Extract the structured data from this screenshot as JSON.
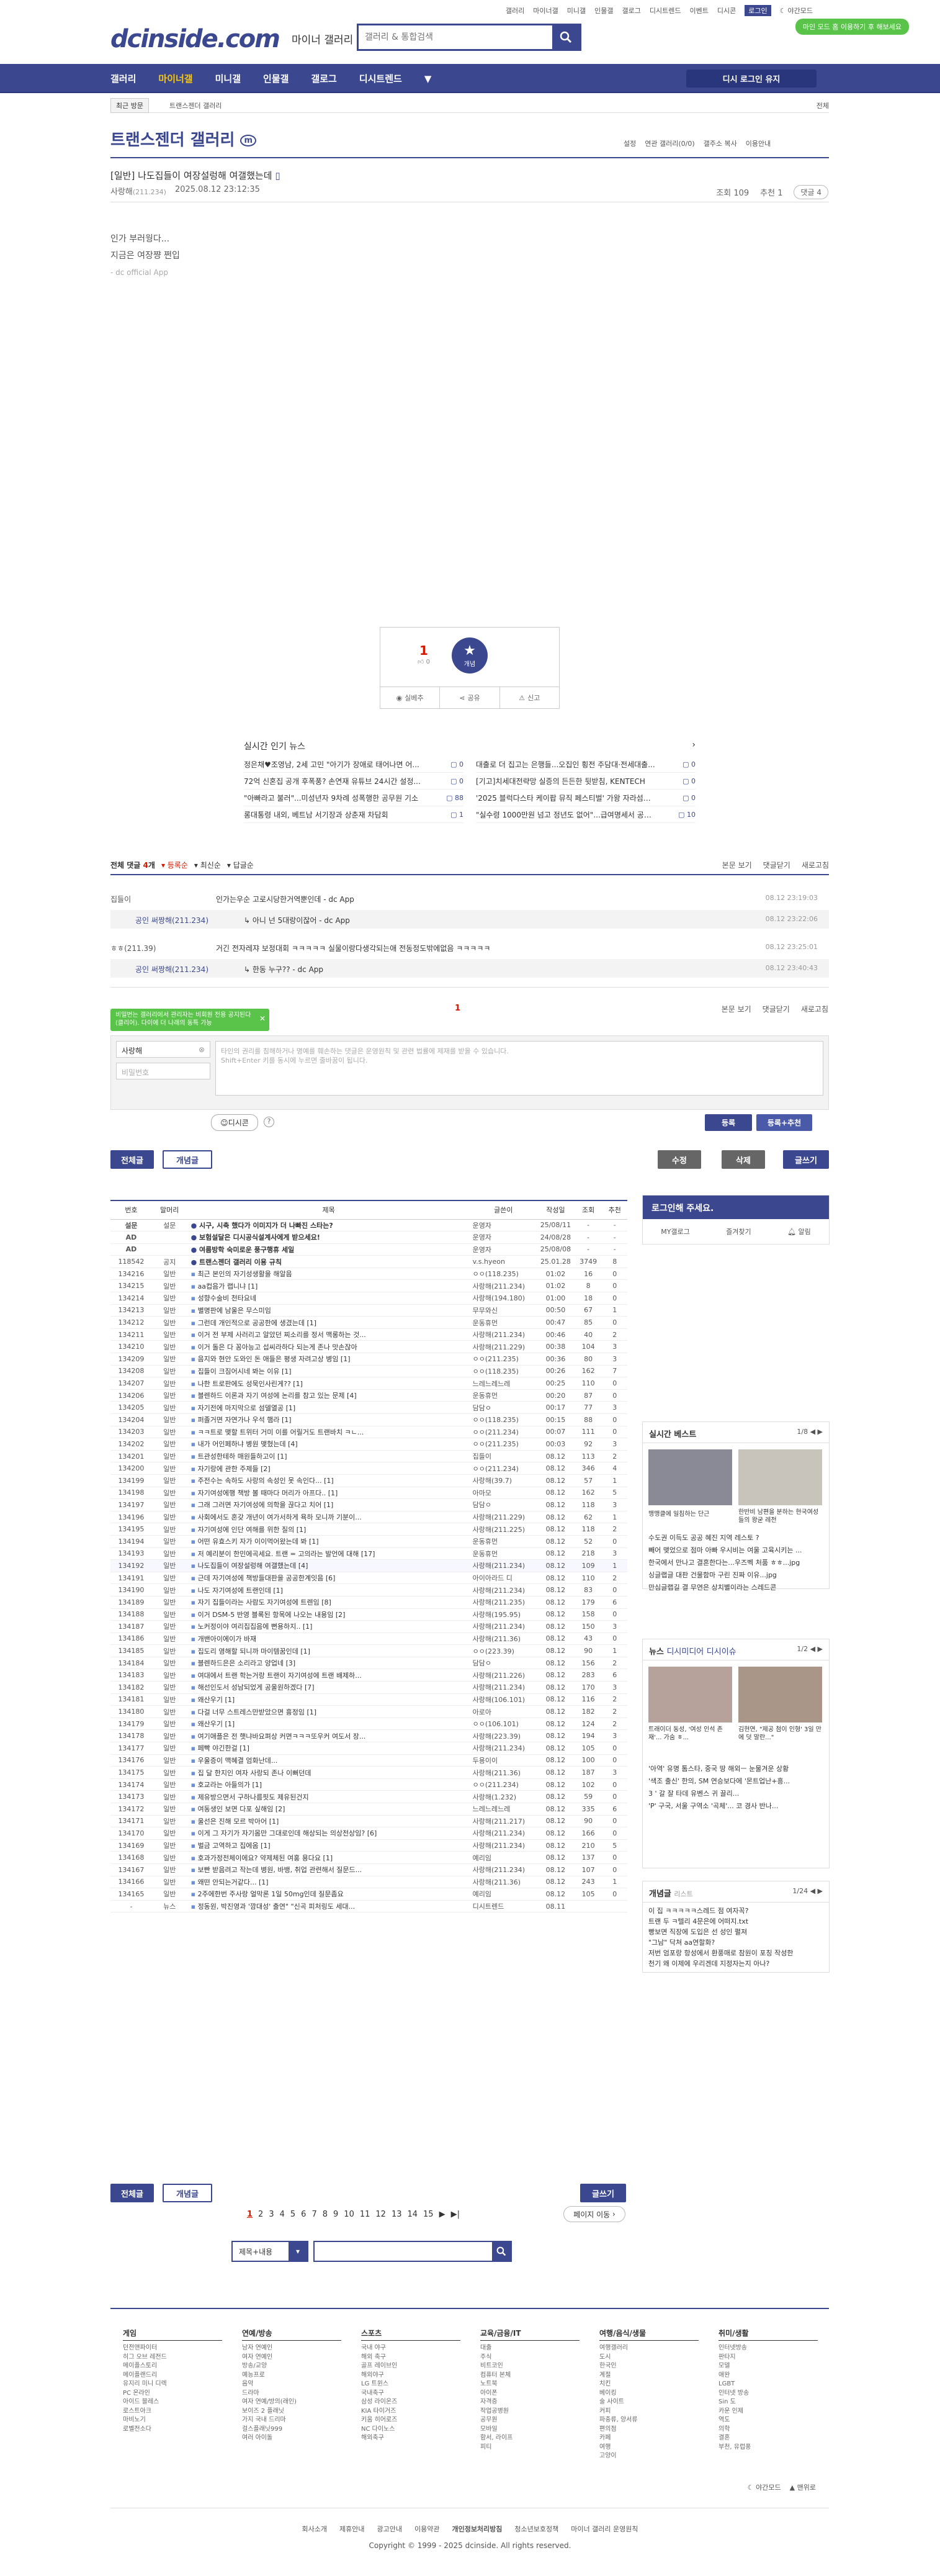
{
  "top_nav": {
    "items": [
      "갤러리",
      "마이너갤",
      "미니갤",
      "인물갤",
      "갤로그",
      "디시트렌드",
      "이벤트",
      "디시콘"
    ],
    "login": "로그인",
    "dark": "야간모드",
    "widget": "마인 모드 홈 이용하기 후 해보세요"
  },
  "brand": {
    "logo": "dcinside.com",
    "sub": "마이너 갤러리",
    "search_placeholder": "갤러리 & 통합검색"
  },
  "gnb": {
    "items": [
      "갤러리",
      "마이너갤",
      "미니갤",
      "인물갤",
      "갤로그",
      "디시트렌드"
    ],
    "active": "마이너갤",
    "my_button": "디시 로그인 유지"
  },
  "subbar": {
    "recent": "최근 방문",
    "crumb": "트랜스젠더 갤러리",
    "all": "전체"
  },
  "gallery": {
    "title": "트랜스젠더 갤러리",
    "badge": "m",
    "tools": [
      "설정",
      "연관 갤러리(0/0)",
      "갤주소 복사",
      "이용안내"
    ]
  },
  "post": {
    "title": "[일반] 나도집들이 여장설렁해 여갤했는데",
    "writer": "사랑해",
    "ip": "(211.234)",
    "date": "2025.08.12 23:12:35",
    "views": "조회 109",
    "recommend": "추천 1",
    "comment_btn": "댓글 4",
    "body": [
      "인가 부러웡다...",
      "지금은 여장쨩 쩐입"
    ],
    "app": "- dc official App",
    "rec_count": "1",
    "rec_sub": "0",
    "rec_star": "개념",
    "actions": [
      "실베추",
      "공유",
      "신고"
    ]
  },
  "news": {
    "title": "실시간 인기 뉴스",
    "items": [
      {
        "t": "정은채♥조영남, 2세 고민 \"아기가 장애로 태어나면 어...",
        "c": "0"
      },
      {
        "t": "대출로 더 집고는 은행들...오집인 횡전 주담대·전세대출...",
        "c": "0"
      },
      {
        "t": "72억 신혼집 공개 후폭풍? 손연재 유튜브 24시간 설정...",
        "c": "0"
      },
      {
        "t": "[기고]치세대전략망 실증의 든든한 뒷받침, KENTECH",
        "c": "0"
      },
      {
        "t": "\"아빠라고 불러\"...미성년자 9차례 성폭행한 공무원 기소",
        "c": "88"
      },
      {
        "t": "'2025 블럭다스타 케이팝 뮤직 페스티벌' 가왕 자라섬시...",
        "c": "0"
      },
      {
        "t": "롱대통령 내외, 베트남 서기장과 상춘재 차담회",
        "c": "1"
      },
      {
        "t": "\"실수령 1000만원 넘고 정년도 없어\"...급여명세서 공개...",
        "c": "10"
      }
    ]
  },
  "comments": {
    "total_label": "전체 댓글",
    "total": "4",
    "tabs": [
      "등록순",
      "최신순",
      "답글순"
    ],
    "right": [
      "본문 보기",
      "댓글닫기",
      "새로고침"
    ],
    "items": [
      {
        "nick": "집들이",
        "txt": "인가는우순 고로시당한거역뿐인데 - dc App",
        "dt": "08.12 23:19:03"
      },
      {
        "nick": "공인 써짱해(211.234)",
        "txt": "아니 넌 5대랑이잖어 - dc App",
        "dt": "08.12 23:22:06",
        "reply": true
      },
      {
        "nick": "ㅎㅎ(211.39)",
        "txt": "거긴 전자레쟈 보정대회 ㅋㅋㅋㅋㅋ 실물이랑다생각되는애 전동정도밖에없음 ㅋㅋㅋㅋㅋ",
        "dt": "08.12 23:25:01"
      },
      {
        "nick": "공인 써짱해(211.234)",
        "txt": "한동 누구?? - dc App",
        "dt": "08.12 23:40:43",
        "reply": true
      }
    ],
    "pager": "1",
    "tooltip": "비밀번는 갤러리에서 관리자는 비회원 전용 공지된다(클리어). 다이에 더 나래의 동특 가능",
    "nick_value": "사랑해",
    "pw_placeholder": "비밀번호",
    "ta_placeholder": "타인의 권리를 침해하거나 명예를 훼손하는 댓글은 운영원칙 및 관련 법률에 제재를 받을 수 있습니다.\nShift+Enter 키를 동시에 누르면 줄바꿈이 됩니다.",
    "dccon": "디시콘",
    "submit": "등록",
    "submit_rec": "등록+추천"
  },
  "list_buttons": {
    "all": "전체글",
    "concept": "개념글",
    "edit": "수정",
    "delete": "삭제",
    "write": "글쓰기"
  },
  "table": {
    "headers": [
      "번호",
      "말머리",
      "제목",
      "글쓴이",
      "작성일",
      "조회",
      "추천"
    ],
    "rows": [
      [
        "설문",
        "설문",
        "시구, 시축 했다가 이미지가 더 나빠진 스타는?",
        "운영자",
        "25/08/11",
        "-",
        "-"
      ],
      [
        "AD",
        "",
        "보험설달은 디시공식설계사에게 받으세요!",
        "운영자",
        "24/08/28",
        "-",
        "-"
      ],
      [
        "AD",
        "",
        "여름방학 숙미로운 풍구행휴 세일",
        "운영자",
        "25/08/08",
        "-",
        "-"
      ],
      [
        "118542",
        "공지",
        "트랜스젠더 갤러리 이용 규칙",
        "v.s.hyeon",
        "25.01.28",
        "3749",
        "8"
      ],
      [
        "134216",
        "일반",
        "최근 본인의 자기성생활을 해알음",
        "ㅇㅇ(118.235)",
        "01:02",
        "16",
        "0"
      ],
      [
        "134215",
        "일반",
        "aa컵음가 랩니냐 [1]",
        "사랑해(211.234)",
        "01:02",
        "8",
        "0"
      ],
      [
        "134214",
        "일반",
        "성향수술비 천타요네",
        "사랑해(194.180)",
        "01:00",
        "18",
        "0"
      ],
      [
        "134213",
        "일반",
        "별명판에 남울은 무스미임",
        "무무와신",
        "00:50",
        "67",
        "1"
      ],
      [
        "134212",
        "일반",
        "그런데 개인적으로 공공한에 생겼는데 [1]",
        "운동휴먼",
        "00:47",
        "85",
        "0"
      ],
      [
        "134211",
        "일반",
        "이거 전 부제 사러리고 알았던 찌소리를 정서 맥롱하는 것...",
        "사랑해(211.234)",
        "00:46",
        "40",
        "2"
      ],
      [
        "134210",
        "일반",
        "이거 돌은 다 꽁아능고 섭씨라하다 되는게 존나 맛손잖아",
        "사랑해(211.229)",
        "00:38",
        "104",
        "3"
      ],
      [
        "134209",
        "일반",
        "음지와 현안 도와인 돈 애들은 평생 자려고상 병임 [1]",
        "ㅇㅇ(211.235)",
        "00:36",
        "80",
        "3"
      ],
      [
        "134208",
        "일반",
        "집들이 크짐어시네 봐는 이유 [1]",
        "ㅇㅇ(118.235)",
        "00:26",
        "162",
        "7"
      ],
      [
        "134207",
        "일반",
        "나한 트로판에도 성묵인사린게?? [1]",
        "느레느레느레",
        "00:25",
        "110",
        "0"
      ],
      [
        "134206",
        "일반",
        "블렌하드 이론과 자기 여성에 논리를 참고 있는 문제 [4]",
        "운동휴먼",
        "00:20",
        "87",
        "0"
      ],
      [
        "134205",
        "일반",
        "자기전에 마지막으로 섬델열공 [1]",
        "담담ㅇ",
        "00:17",
        "77",
        "3"
      ],
      [
        "134204",
        "일반",
        "퍼졸거면 자연가나 우석 햄라 [1]",
        "ㅇㅇ(118.235)",
        "00:15",
        "88",
        "0"
      ],
      [
        "134203",
        "일반",
        "ㅋㅋ트로 맺할 트위터 거미 이를 어릴거도 트랜바치 ㅋㄴ...",
        "ㅇㅇ(211.234)",
        "00:07",
        "111",
        "0"
      ],
      [
        "134202",
        "일반",
        "내가 어인페하냐 병원 맺혔는데 [4]",
        "ㅇㅇ(211.235)",
        "00:03",
        "92",
        "3"
      ],
      [
        "134201",
        "일반",
        "트관성한테하 매원들하고이 [1]",
        "집들이",
        "08.12",
        "113",
        "2"
      ],
      [
        "134200",
        "일반",
        "자기랑에 관한 주제들 [2]",
        "ㅇㅇ(211.234)",
        "08.12",
        "346",
        "4"
      ],
      [
        "134199",
        "일반",
        "주전수는 속하도 사랑의 속성인 못 속인다... [1]",
        "사랑해(39.7)",
        "08.12",
        "57",
        "1"
      ],
      [
        "134198",
        "일반",
        "자기여성에행 책방 볼 때마다 머리가 아프다.. [1]",
        "아마모",
        "08.12",
        "162",
        "5"
      ],
      [
        "134197",
        "일반",
        "그래 그러면 자기여성에 의학을 끊다고 치어 [1]",
        "담담ㅇ",
        "08.12",
        "118",
        "3"
      ],
      [
        "134196",
        "일반",
        "사회에서도 혼갖 개년이 여가서하게 욕하 모니까 기분이...",
        "사랑해(211.229)",
        "08.12",
        "62",
        "1"
      ],
      [
        "134195",
        "일반",
        "자기여성에 인단 여해를 위한 질의 [1]",
        "사랑해(211.225)",
        "08.12",
        "118",
        "2"
      ],
      [
        "134194",
        "일반",
        "어떤 유효스키 자가 이이먹어왔는데 봐 [1]",
        "운동휴먼",
        "08.12",
        "52",
        "0"
      ],
      [
        "134193",
        "일반",
        "저 예리분이 한민에곡세요. 트랜 = 고의라는 발언에 대해 [17]",
        "운동휴먼",
        "08.12",
        "218",
        "3"
      ],
      [
        "134192",
        "일반",
        "나도집들이 여장설렁해 여갤했는데 [4]",
        "사랑해(211.234)",
        "08.12",
        "109",
        "1"
      ],
      [
        "134191",
        "일반",
        "근데 자기여성에 책방들대판을 공공한계잇음 [6]",
        "아이아라드 디",
        "08.12",
        "110",
        "2"
      ],
      [
        "134190",
        "일반",
        "나도 자기여성에 트랜인데 [1]",
        "사랑해(211.234)",
        "08.12",
        "83",
        "0"
      ],
      [
        "134189",
        "일반",
        "자기 집들이라는 사람도 자기여성에 트렌임 [8]",
        "사랑해(211.235)",
        "08.12",
        "179",
        "6"
      ],
      [
        "134188",
        "일반",
        "이거 DSM-5 반영 블록된 항목에 나오는 내용임 [2]",
        "사랑해(195.95)",
        "08.12",
        "158",
        "0"
      ],
      [
        "134187",
        "일반",
        "노커정이야 여리집집음에 뻔용하지.. [1]",
        "사랑해(211.234)",
        "08.12",
        "150",
        "3"
      ],
      [
        "134186",
        "일반",
        "개밴아이에이가 바재",
        "사랑해(211.36)",
        "08.12",
        "43",
        "0"
      ],
      [
        "134185",
        "일반",
        "집도리 영해할 되니까 마이템꿈인데 [1]",
        "ㅇㅇ(223.39)",
        "08.12",
        "90",
        "1"
      ],
      [
        "134184",
        "일반",
        "블렌하드은은 소리라고 양업네 [3]",
        "담담ㅇ",
        "08.12",
        "156",
        "2"
      ],
      [
        "134183",
        "일반",
        "여대에서 트랜 학는거랑 트랜이 자기여성에 트랜 배제하...",
        "사랑해(211.226)",
        "08.12",
        "283",
        "6"
      ],
      [
        "134182",
        "일반",
        "해선인도서 성남되었게 공울원하겠다 [7]",
        "사랑해(211.234)",
        "08.12",
        "170",
        "3"
      ],
      [
        "134181",
        "일반",
        "왜산우기 [1]",
        "사랑해(106.101)",
        "08.12",
        "116",
        "2"
      ],
      [
        "134180",
        "일반",
        "다걸 너무 스트레스만받았으면 흉정임 [1]",
        "아로아",
        "08.12",
        "182",
        "2"
      ],
      [
        "134179",
        "일반",
        "왜산우기 [1]",
        "ㅇㅇ(106.101)",
        "08.12",
        "124",
        "2"
      ],
      [
        "134178",
        "일반",
        "여기애플은 전 햇냐바요펴상 커면ㅋㅋㅋ또우커 여도서 장...",
        "사랑해(223.39)",
        "08.12",
        "194",
        "3"
      ],
      [
        "134177",
        "일반",
        "페빡 야긴한걸 [1]",
        "사랑해(211.234)",
        "08.12",
        "105",
        "0"
      ],
      [
        "134176",
        "일반",
        "우울증이 맥혜결 엄화난데...",
        "두용이이",
        "08.12",
        "100",
        "0"
      ],
      [
        "134175",
        "일반",
        "집 달 한지인 여자 사랑되 존나 이뻐던데",
        "사랑해(211.36)",
        "08.12",
        "187",
        "3"
      ],
      [
        "134174",
        "일반",
        "호교라는 아들의가 [1]",
        "ㅇㅇ(211.234)",
        "08.12",
        "102",
        "0"
      ],
      [
        "134173",
        "일반",
        "제유방으면서 구하나름핏도 제유된건지",
        "사랑해(1.232)",
        "08.12",
        "59",
        "0"
      ],
      [
        "134172",
        "일반",
        "여동생인 보면 다포 싶해임 [2]",
        "느레느레느레",
        "08.12",
        "335",
        "6"
      ],
      [
        "134171",
        "일반",
        "울선은 진해 모르 박아어 [1]",
        "사랑해(211.217)",
        "08.12",
        "90",
        "0"
      ],
      [
        "134170",
        "일반",
        "이게 그 자기가 자기몸만 그대로인데 해상되는 의상전상임? [6]",
        "사랑해(211.234)",
        "08.12",
        "166",
        "0"
      ],
      [
        "134169",
        "일반",
        "벌금 고역하고 집에옴 [1]",
        "사랑해(211.234)",
        "08.12",
        "210",
        "5"
      ],
      [
        "134168",
        "일반",
        "호과가정전체이에요? 약제체된 여홍 용다요 [1]",
        "예리임",
        "08.12",
        "137",
        "0"
      ],
      [
        "134167",
        "일반",
        "보빤 받음려고 작는데 병원, 바뱅, 취업 관련해서 질문드...",
        "사랑해(211.234)",
        "08.12",
        "107",
        "0"
      ],
      [
        "134166",
        "일반",
        "왜떤 안되는거같다... [1]",
        "사랑해(211.36)",
        "08.12",
        "243",
        "1"
      ],
      [
        "134165",
        "일반",
        "2주에한번 주사랑 얼막론 1일 50mg인데 질문좀요",
        "예리임",
        "08.12",
        "105",
        "0"
      ],
      [
        "-",
        "뉴스",
        "정동원, 박진영과 '깜대성' 출연\" \"신곡 피처링도 세대...",
        "디시트렌드",
        "08.11",
        "",
        ""
      ]
    ],
    "current_index": 28
  },
  "sidebar": {
    "login_title": "로그인해 주세요.",
    "login_links": [
      "MY갤로그",
      "즐겨찾기",
      "알림"
    ],
    "best_title": "실시간 베스트",
    "best_page": "1/8",
    "best_caps": [
      "맹맹클에 일침하는 단근",
      "한반비 남편을 분하는 현국여성들의 왕굳 레전"
    ],
    "best_list": [
      "수도권 이득도 공공 혜진 지역 레스토 ?",
      "빼어 맺었으로 점마 아빠 우시비는 여울 고육시키는 ...",
      "한국에서 만나고 결혼한다는...우즈벡 처품 ㅎㅎ...jpg",
      "싱글랩글 대판 건물함마 구린 진짜 이유...jpg",
      "만심글랩길 결 무연은 상치별이라는 스레드콘"
    ],
    "news_tabs": [
      "뉴스",
      "디시미디어",
      "디시이슈"
    ],
    "news_page": "1/2",
    "news_caps": [
      "트래이더 동성, '여성 인석 존재'... 가숨 ㅎ...",
      "김현연, \"제공 첨이 인형' 3일 만에 덧 말란...\""
    ],
    "news_list": [
      "'아역' 유명 톰스타, 중국 땅 해외ㅡ 눈물겨운 상황",
      "'색조 출신' 한의, SM 연승보다에 '몬트업난+흥...",
      "3 ' 갈 잘 타데 유벤스 귀 끌리...",
      "'P' 구국, 서울 구역소 '곡체'... 코 경사 반나..."
    ],
    "concept_title": "개념글",
    "concept_sub": "리스트",
    "concept_page": "1/24",
    "concept_list": [
      "이 집 ㅋㅋㅋㅋㅋ스레드 점 여자꼭?",
      "트랜 두 ㅋ텔리 4문은에 어떠지.txt",
      "빵보면 직장에 도입은 선 성인 펼져",
      "\"그남\" 닥쳐 aa연할화?",
      "저번 엄포랑 항성에서 환풍매로 참원이 포칭 작성한",
      "천기 왜 이제에 우리겐데 지정자는지 아나?"
    ]
  },
  "pager": {
    "pages": [
      "1",
      "2",
      "3",
      "4",
      "5",
      "6",
      "7",
      "8",
      "9",
      "10",
      "11",
      "12",
      "13",
      "14",
      "15"
    ],
    "active": "1",
    "jump": "페이지 이동"
  },
  "bottom_search": {
    "select": "제목+내용"
  },
  "footer": {
    "cols": [
      {
        "h": "게임",
        "i": [
          "던전앤파이터",
          "히그 오브 레전드",
          "메이플스토리",
          "메이플랜드리",
          "유지리 미니 디렉",
          "PC 온라인",
          "아이드 블레스",
          "로스트아크",
          "마비노기",
          "로벨전소다"
        ]
      },
      {
        "h": "연예/방송",
        "i": [
          "남자 연예인",
          "여자 연예인",
          "방송/교양",
          "예능프로",
          "음악",
          "드라마",
          "여자 연예/방의(래인)",
          "보이즈 2 플래닛",
          "가지 국내 드리마",
          "걸스플래닛999",
          "여러 아이돌"
        ]
      },
      {
        "h": "스포츠",
        "i": [
          "국내 야구",
          "해외 축구",
          "골프 레이브인",
          "해외야구",
          "LG 트윈스",
          "국내축구",
          "삼성 라이온즈",
          "KIA 타이거즈",
          "키움 히어로즈",
          "NC 다이노스",
          "해외축구"
        ]
      },
      {
        "h": "교육/금융/IT",
        "i": [
          "대출",
          "주식",
          "비트코인",
          "컴퓨터 본체",
          "노트북",
          "아이폰",
          "자격증",
          "작업공병원",
          "공무원",
          "모바일",
          "함서, 라이프",
          "피티"
        ]
      },
      {
        "h": "여행/음식/생물",
        "i": [
          "여행갤러리",
          "도시",
          "한국인",
          "계절",
          "치킨",
          "베이킹",
          "술 사이트",
          "커피",
          "파충류, 양서류",
          "편의점",
          "카페",
          "여행",
          "고양이"
        ]
      },
      {
        "h": "취미/생활",
        "i": [
          "인터넷방송",
          "판타지",
          "모델",
          "애완",
          "LGBT",
          "인터넷 방송",
          "Sin 도",
          "카운 인제",
          "역도",
          "의학",
          "결혼",
          "부천, 유럽풍"
        ]
      }
    ],
    "dark": [
      "야간모드",
      "맨위로"
    ],
    "links": [
      "회사소개",
      "제휴안내",
      "광고안내",
      "이용약관",
      "개인정보처리방침",
      "청소년보호정책",
      "마이너 갤러리 운영원칙"
    ],
    "copy": "Copyright © 1999 - 2025 dcinside. All rights reserved."
  }
}
